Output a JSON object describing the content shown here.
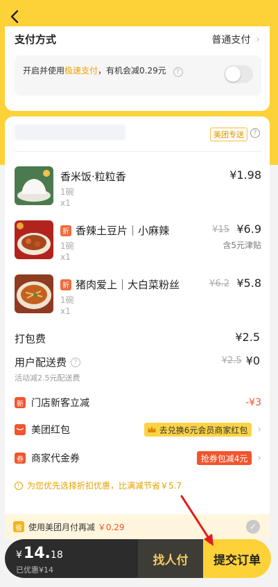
{
  "colors": {
    "brand_yellow": "#fdd239",
    "accent_orange": "#f2542d",
    "highlight": "#f0a000"
  },
  "header": {
    "back_icon": "chevron-left-icon"
  },
  "payment": {
    "title": "支付方式",
    "method": "普通支付",
    "promo_prefix": "开启并使用",
    "promo_highlight": "极速支付",
    "promo_suffix": "，有机会减0.29元"
  },
  "store": {
    "delivery_badge": "美团专送"
  },
  "items": [
    {
      "name": "香米饭·粒粒香",
      "unit": "1碗",
      "qty": "x1",
      "price": "¥1.98",
      "discount": false
    },
    {
      "name": "香辣土豆片｜小麻辣",
      "unit": "1碗",
      "qty": "x1",
      "orig_price": "¥15",
      "price": "¥6.9",
      "subsidy": "含5元津贴",
      "discount": true,
      "tag": "折"
    },
    {
      "name": "猪肉爱上｜大白菜粉丝",
      "unit": "1碗",
      "qty": "x1",
      "orig_price": "¥6.2",
      "price": "¥5.8",
      "discount": true,
      "tag": "折"
    }
  ],
  "fees": {
    "packing_label": "打包费",
    "packing_value": "¥2.5",
    "delivery_label": "用户配送费",
    "delivery_orig": "¥2.5",
    "delivery_value": "¥0",
    "delivery_note": "活动减2.5元配送费"
  },
  "promos": {
    "new_customer": {
      "icon": "新",
      "label": "门店新客立减",
      "value": "-¥3"
    },
    "red_packet": {
      "label": "美团红包",
      "badge": "去兑换6元会员商家红包"
    },
    "voucher": {
      "icon": "券",
      "label": "商家代金券",
      "badge": "抢券包减4元"
    }
  },
  "tip": "为您优先选择折扣优惠，比满减节省￥5.7",
  "monthly_pay": {
    "icon": "省",
    "text": "使用美团月付再减",
    "amount": "￥0.29"
  },
  "checkout": {
    "currency": "¥",
    "total_int": "14.",
    "total_dec": "18",
    "saved": "已优惠¥14",
    "friend_pay": "找人付",
    "submit": "提交订单"
  }
}
